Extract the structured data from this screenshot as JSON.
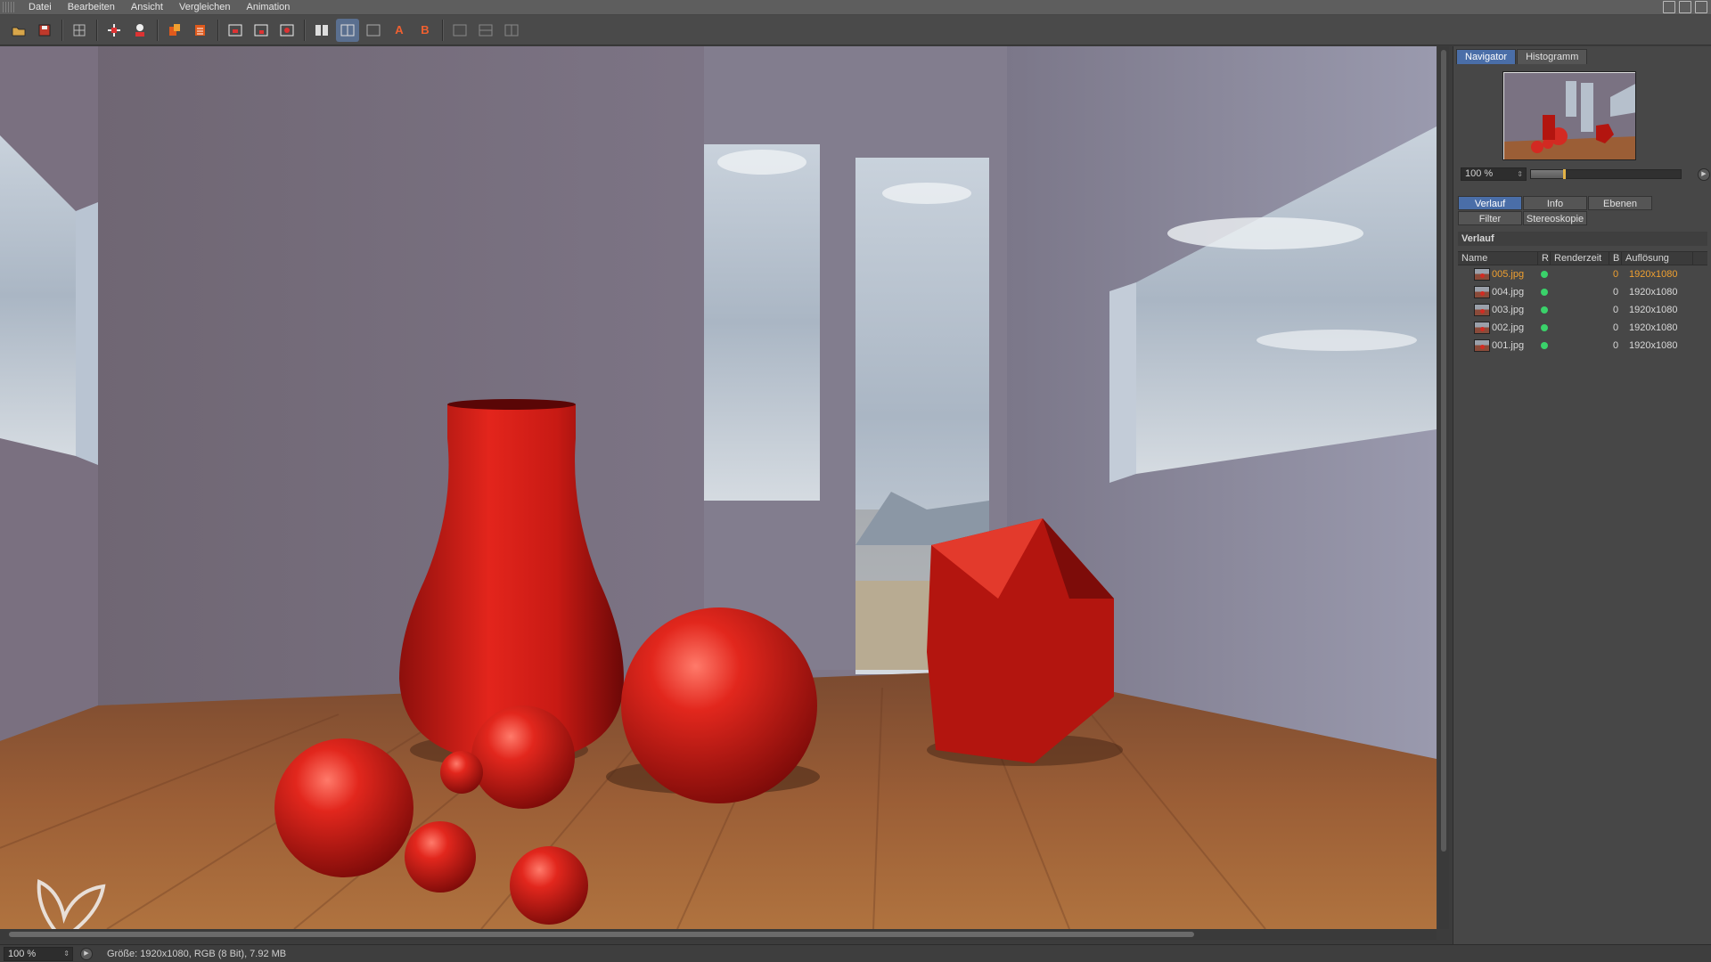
{
  "menu": [
    "Datei",
    "Bearbeiten",
    "Ansicht",
    "Vergleichen",
    "Animation"
  ],
  "toolbar": {
    "buttons": [
      "open-icon",
      "save-icon",
      "grid-icon",
      "move-icon",
      "person-icon",
      "copy-icon",
      "layers-icon",
      "region-icon",
      "region-alt-icon",
      "render-icon",
      "compare-ab-icon",
      "compare-split-icon",
      "ab-icon",
      "a-icon",
      "b-icon",
      "view1-icon",
      "view2-icon",
      "view3-icon"
    ],
    "ab_labels": {
      "a": "A",
      "b": "B"
    }
  },
  "statusbar": {
    "zoom": "100 %",
    "info": "Größe: 1920x1080, RGB (8 Bit), 7.92 MB"
  },
  "panel": {
    "top_tabs": [
      "Navigator",
      "Histogramm"
    ],
    "active_top_tab": "Navigator",
    "nav_zoom": "100 %",
    "nav_slider_fraction": 0.22,
    "sub_tabs_row1": [
      "Verlauf",
      "Info",
      "Ebenen"
    ],
    "sub_tabs_row2": [
      "Filter",
      "Stereoskopie"
    ],
    "active_sub_tab": "Verlauf",
    "section_title": "Verlauf",
    "columns": {
      "name": "Name",
      "r": "R",
      "time": "Renderzeit",
      "b": "B",
      "res": "Auflösung"
    },
    "rows": [
      {
        "name": "005.jpg",
        "b": "0",
        "res": "1920x1080",
        "selected": true
      },
      {
        "name": "004.jpg",
        "b": "0",
        "res": "1920x1080",
        "selected": false
      },
      {
        "name": "003.jpg",
        "b": "0",
        "res": "1920x1080",
        "selected": false
      },
      {
        "name": "002.jpg",
        "b": "0",
        "res": "1920x1080",
        "selected": false
      },
      {
        "name": "001.jpg",
        "b": "0",
        "res": "1920x1080",
        "selected": false
      }
    ]
  },
  "colors": {
    "accent": "#4a6ea8",
    "selected_text": "#f0a030",
    "status_green": "#3ad26a",
    "object_red": "#d32a22"
  }
}
